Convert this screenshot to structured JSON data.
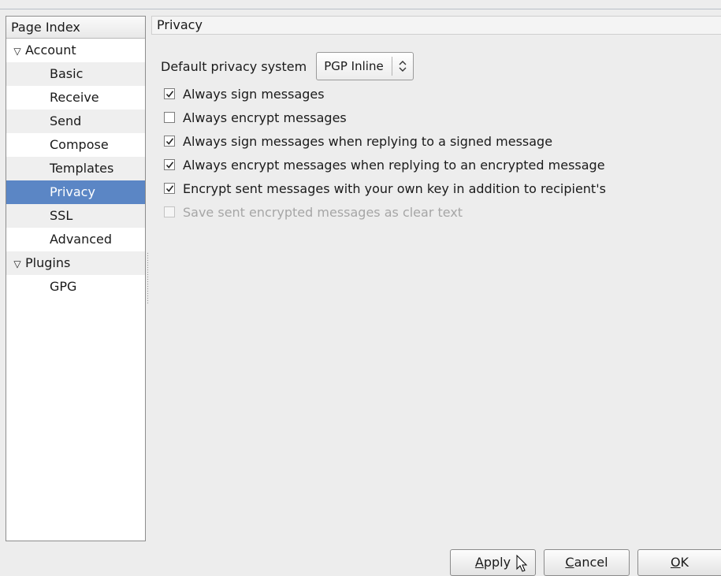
{
  "sidebar": {
    "header": "Page Index",
    "items": [
      {
        "label": "Account",
        "type": "parent",
        "expander": "▽"
      },
      {
        "label": "Basic",
        "type": "child"
      },
      {
        "label": "Receive",
        "type": "child"
      },
      {
        "label": "Send",
        "type": "child"
      },
      {
        "label": "Compose",
        "type": "child"
      },
      {
        "label": "Templates",
        "type": "child"
      },
      {
        "label": "Privacy",
        "type": "child",
        "selected": true
      },
      {
        "label": "SSL",
        "type": "child"
      },
      {
        "label": "Advanced",
        "type": "child"
      },
      {
        "label": "Plugins",
        "type": "parent",
        "expander": "▽"
      },
      {
        "label": "GPG",
        "type": "child"
      }
    ]
  },
  "page": {
    "title": "Privacy",
    "default_privacy_label": "Default privacy system",
    "default_privacy_value": "PGP Inline",
    "checkboxes": [
      {
        "label": "Always sign messages",
        "checked": true,
        "enabled": true
      },
      {
        "label": "Always encrypt messages",
        "checked": false,
        "enabled": true
      },
      {
        "label": "Always sign messages when replying to a signed message",
        "checked": true,
        "enabled": true
      },
      {
        "label": "Always encrypt messages when replying to an encrypted message",
        "checked": true,
        "enabled": true
      },
      {
        "label": "Encrypt sent messages with your own key in addition to recipient's",
        "checked": true,
        "enabled": true
      },
      {
        "label": "Save sent encrypted messages as clear text",
        "checked": false,
        "enabled": false
      }
    ]
  },
  "buttons": {
    "apply": {
      "mnemonic": "A",
      "rest": "pply"
    },
    "cancel": {
      "mnemonic": "C",
      "rest": "ancel"
    },
    "ok": {
      "mnemonic": "O",
      "rest": "K"
    }
  },
  "colors": {
    "selection": "#5b86c5",
    "window_bg": "#ededed"
  },
  "icons": {
    "checked": "☑",
    "combo_arrows": "⌃⌄"
  }
}
